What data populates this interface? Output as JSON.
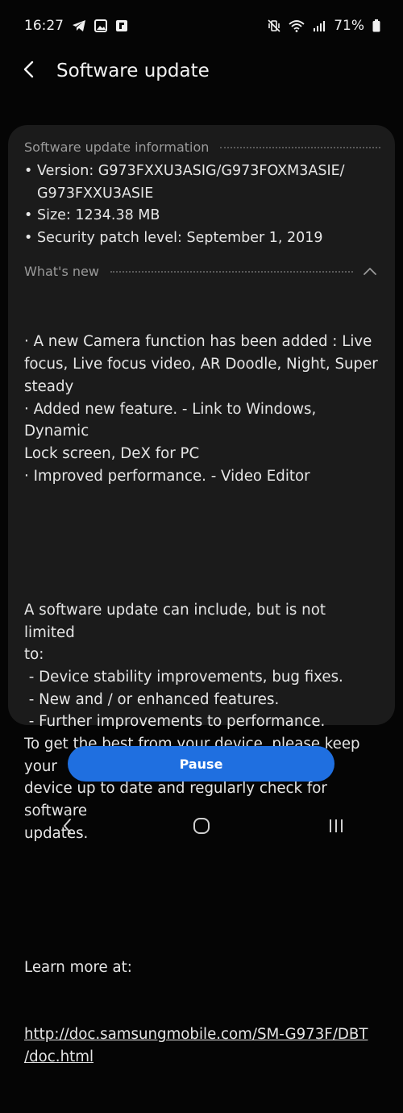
{
  "status_bar": {
    "time": "16:27",
    "left_icons": [
      "telegram-icon",
      "gallery-icon",
      "flipboard-icon"
    ],
    "right_icons": [
      "mute-vibrate-icon",
      "wifi-icon",
      "signal-icon",
      "battery-icon"
    ],
    "battery": "71%"
  },
  "app_bar": {
    "back_icon": "back-arrow-icon",
    "title": "Software update"
  },
  "update_info": {
    "header": "Software update information",
    "items": [
      "Version: G973FXXU3ASIG/G973FOXM3ASIE/\nG973FXXU3ASIE",
      "Size: 1234.38 MB",
      "Security patch level: September 1, 2019"
    ]
  },
  "whats_new": {
    "header": "What's new",
    "expanded": true,
    "p1": "· A new Camera function has been added : Live\nfocus, Live focus video, AR Doodle, Night, Super\nsteady\n· Added new feature. - Link to Windows, Dynamic\nLock screen, DeX for PC\n· Improved performance. - Video Editor",
    "p2": "A software update can include, but is not limited\nto:\n - Device stability improvements, bug fixes.\n - New and / or enhanced features.\n - Further improvements to performance.\nTo get the best from your device, please keep your\ndevice up to date and regularly check for software\nupdates.",
    "learn_more": "Learn more at:",
    "link": "http://doc.samsungmobile.com/SM-G973F/DBT\n/doc.html"
  },
  "actions": {
    "pause_label": "Pause"
  },
  "nav_bar": {
    "icons": [
      "recents-back-icon",
      "home-icon",
      "recent-apps-icon"
    ]
  },
  "colors": {
    "background": "#050505",
    "card": "#1b1b1b",
    "accent_button": "#1f6fe0",
    "section_header": "#9a9a9a"
  }
}
